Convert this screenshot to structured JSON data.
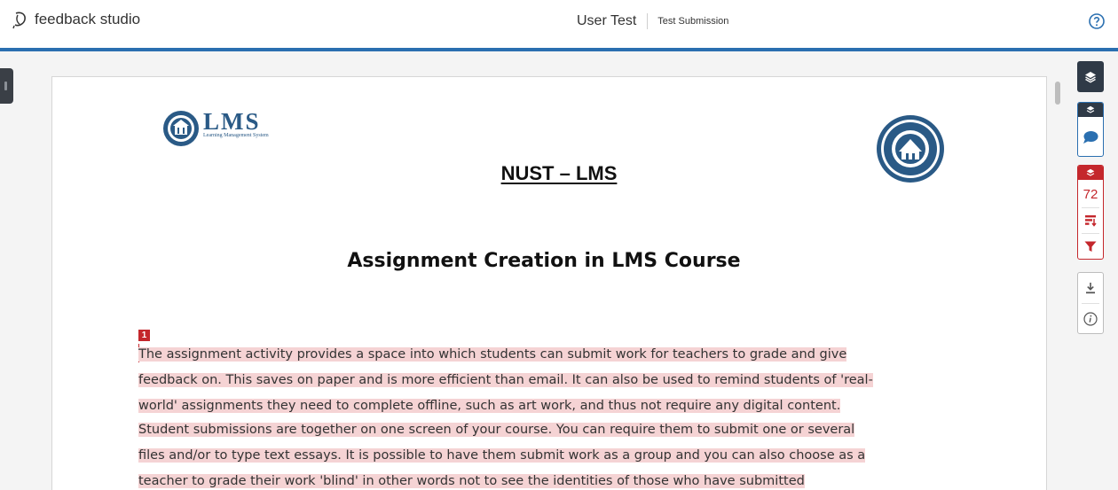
{
  "header": {
    "brand": "feedback studio",
    "title": "User Test",
    "subtitle": "Test Submission",
    "icons": {
      "brand": "feedback-studio-logo-icon",
      "help": "help-icon"
    }
  },
  "document": {
    "logo_text": "LMS",
    "logo_subtext": "Learning Management System",
    "heading": "NUST – LMS",
    "title": "Assignment Creation in LMS Course",
    "match_marker": "1",
    "paragraph1": [
      "The assignment activity provides a space into which students can submit work for teachers to grade and give",
      "feedback on. This saves on paper and is more efficient than email. It can also be used to remind students of 'real-",
      "world' assignments they need to complete offline, such as art work, and thus not require any digital content."
    ],
    "paragraph2": [
      "Student submissions are together on one screen of your course. You can require them to submit one or several",
      "files and/or to type text essays. It is possible to have them submit work as a group and you can also choose as a",
      "teacher to grade their work 'blind' in other words not to see the identities of those who have submitted"
    ]
  },
  "toolbar": {
    "similarity_score": "72",
    "icons": [
      "layers-icon",
      "grading-layer-icon",
      "comment-icon",
      "similarity-layer-icon",
      "sort-icon",
      "filter-icon",
      "download-icon",
      "info-icon"
    ]
  },
  "colors": {
    "accent_blue": "#2a6fb0",
    "similarity_red": "#c4272c",
    "highlight": "#f5d3d4",
    "toolbar_dark": "#2f3a47"
  }
}
